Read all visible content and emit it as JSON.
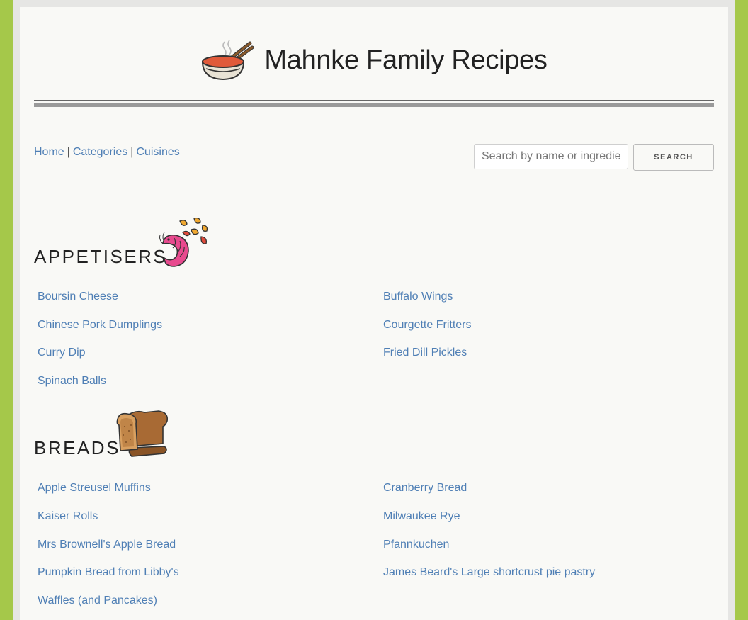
{
  "site": {
    "title": "Mahnke Family Recipes",
    "logo_icon": "soup-bowl-chopsticks-icon"
  },
  "nav": {
    "items": [
      "Home",
      "Categories",
      "Cuisines"
    ],
    "separator": "|"
  },
  "search": {
    "placeholder": "Search by name or ingredient",
    "button_label": "SEARCH"
  },
  "colors": {
    "background": "#a5c84a",
    "page": "#f9f9f6",
    "link": "#4f7fb5"
  },
  "sections": [
    {
      "title": "APPETISERS",
      "icon": "shrimp-chips-icon",
      "left": [
        "Boursin Cheese",
        "Chinese Pork Dumplings",
        "Curry Dip",
        "Spinach Balls"
      ],
      "right": [
        "Buffalo Wings",
        "Courgette Fritters",
        "Fried Dill Pickles"
      ]
    },
    {
      "title": "BREADS",
      "icon": "bread-loaf-icon",
      "left": [
        "Apple Streusel Muffins",
        "Kaiser Rolls",
        "Mrs Brownell's Apple Bread",
        "Pumpkin Bread from Libby's",
        "Waffles (and Pancakes)"
      ],
      "right": [
        "Cranberry Bread",
        "Milwaukee Rye",
        "Pfannkuchen",
        "James Beard's Large shortcrust pie pastry"
      ]
    }
  ]
}
